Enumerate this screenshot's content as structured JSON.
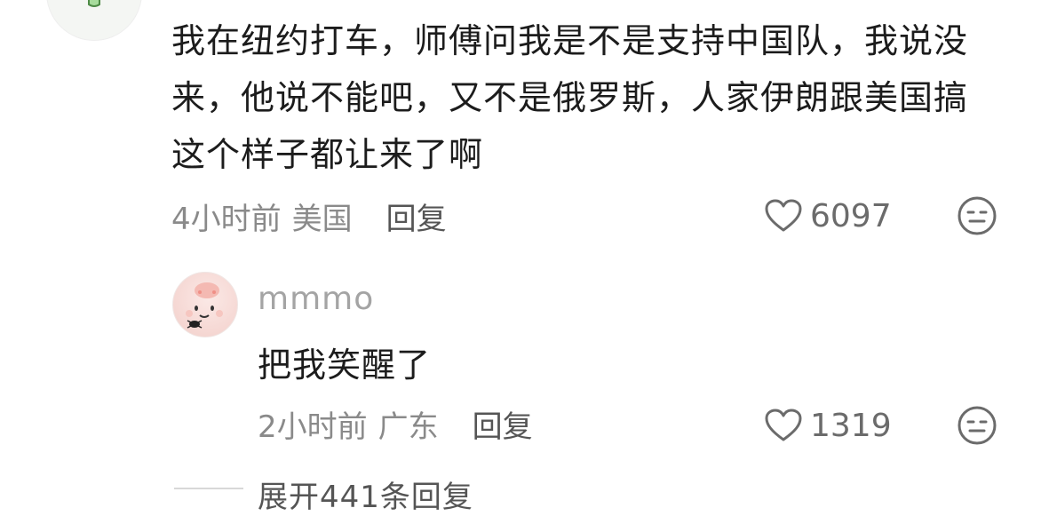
{
  "comment": {
    "text": "我在纽约打车，师傅问我是不是支持中国队，我说没来，他说不能吧，又不是俄罗斯，人家伊朗跟美国搞这个样子都让来了啊",
    "time": "4小时前",
    "location": "美国",
    "reply_label": "回复",
    "likes": "6097",
    "avatar_icon": "broccoli-avatar-icon"
  },
  "sub_reply": {
    "username": "mmmo",
    "text": "把我笑醒了",
    "time": "2小时前",
    "location": "广东",
    "reply_label": "回复",
    "likes": "1319",
    "avatar_icon": "pink-bun-avatar-icon"
  },
  "expand": {
    "label": "展开441条回复"
  },
  "colors": {
    "text": "#1c1c1c",
    "meta": "#8a8a8a",
    "username": "#a4a4a4",
    "avatar_green": "#74b36b"
  }
}
